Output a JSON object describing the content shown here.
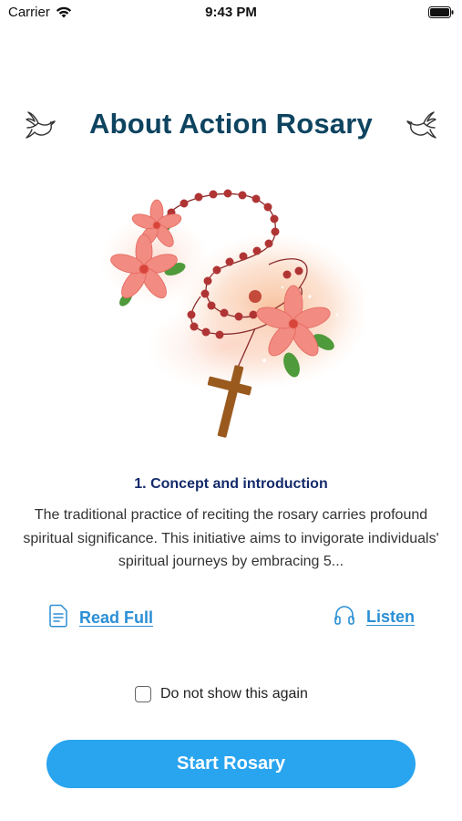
{
  "status_bar": {
    "carrier": "Carrier",
    "time": "9:43 PM",
    "icons": [
      "wifi-icon",
      "battery-icon"
    ]
  },
  "header": {
    "title": "About Action Rosary",
    "left_icon": "dove-icon",
    "right_icon": "dove-icon"
  },
  "hero": {
    "image": "rosary-with-flowers-illustration"
  },
  "content": {
    "heading": "1. Concept and introduction",
    "description": "The traditional practice of reciting the rosary carries profound spiritual significance. This initiative aims to invigorate individuals' spiritual journeys by embracing 5..."
  },
  "actions": {
    "read_full": {
      "label": "Read Full",
      "icon": "document-icon"
    },
    "listen": {
      "label": "Listen",
      "icon": "headphones-icon"
    }
  },
  "checkbox": {
    "label": "Do not show this again",
    "checked": false
  },
  "primary_button": {
    "label": "Start Rosary",
    "color": "#29a4ef"
  },
  "colors": {
    "title": "#0e4460",
    "heading": "#142a6b",
    "link": "#2b8fd6"
  }
}
